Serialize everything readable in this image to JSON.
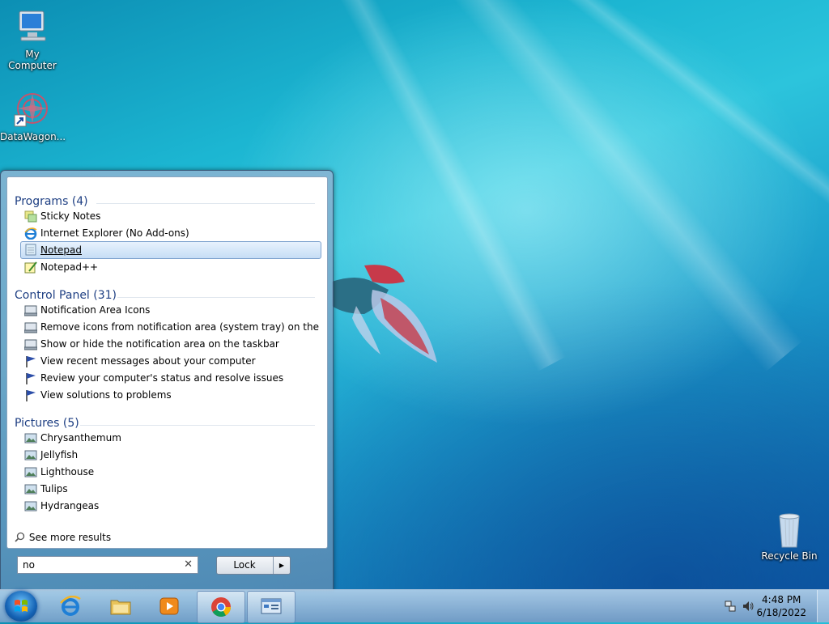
{
  "desktop": {
    "icons": [
      {
        "label": "My Computer",
        "icon": "computer-icon"
      },
      {
        "label": "DataWagon...",
        "icon": "datawagon-shortcut-icon"
      },
      {
        "label": "Recycle Bin",
        "icon": "recycle-bin-icon"
      }
    ]
  },
  "start_menu": {
    "sections": [
      {
        "header": "Programs (4)",
        "items": [
          {
            "label": "Sticky Notes",
            "icon": "sticky-notes-icon"
          },
          {
            "label": "Internet Explorer (No Add-ons)",
            "icon": "internet-explorer-icon"
          },
          {
            "label": "Notepad",
            "icon": "notepad-icon",
            "selected": true
          },
          {
            "label": "Notepad++",
            "icon": "notepad-plus-plus-icon"
          }
        ]
      },
      {
        "header": "Control Panel (31)",
        "items": [
          {
            "label": "Notification Area Icons",
            "icon": "control-panel-icon"
          },
          {
            "label": "Remove icons from notification area (system tray) on the deskt...",
            "icon": "control-panel-icon"
          },
          {
            "label": "Show or hide the notification area on the taskbar",
            "icon": "control-panel-icon"
          },
          {
            "label": "View recent messages about your computer",
            "icon": "action-center-flag-icon"
          },
          {
            "label": "Review your computer's status and resolve issues",
            "icon": "action-center-flag-icon"
          },
          {
            "label": "View solutions to problems",
            "icon": "action-center-flag-icon"
          }
        ]
      },
      {
        "header": "Pictures (5)",
        "items": [
          {
            "label": "Chrysanthemum",
            "icon": "picture-icon"
          },
          {
            "label": "Jellyfish",
            "icon": "picture-icon"
          },
          {
            "label": "Lighthouse",
            "icon": "picture-icon"
          },
          {
            "label": "Tulips",
            "icon": "picture-icon"
          },
          {
            "label": "Hydrangeas",
            "icon": "picture-icon"
          }
        ]
      }
    ],
    "see_more": "See more results",
    "search_value": "no",
    "lock_label": "Lock"
  },
  "taskbar": {
    "pinned": [
      {
        "name": "internet-explorer",
        "icon": "internet-explorer-icon"
      },
      {
        "name": "windows-explorer",
        "icon": "folder-icon"
      },
      {
        "name": "media-player",
        "icon": "media-player-icon"
      },
      {
        "name": "chrome",
        "icon": "chrome-icon",
        "active": true
      },
      {
        "name": "control-panel",
        "icon": "control-panel-window-icon",
        "active": true
      }
    ],
    "clock": {
      "time": "4:48 PM",
      "date": "6/18/2022"
    }
  }
}
